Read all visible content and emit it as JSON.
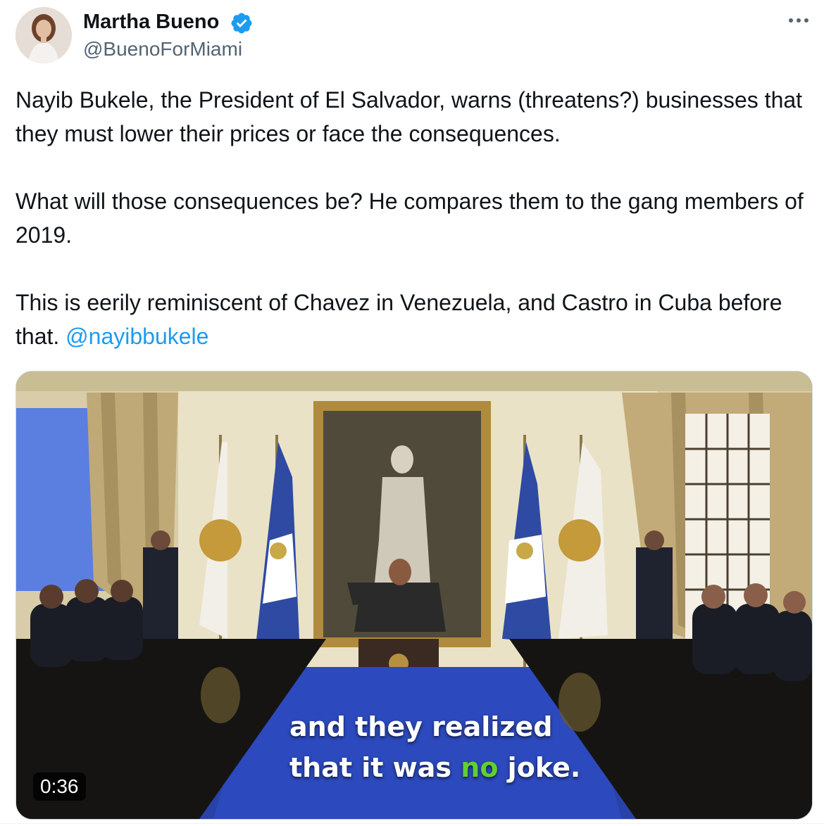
{
  "author": {
    "display_name": "Martha Bueno",
    "handle": "@BuenoForMiami",
    "verified_icon": "verified-badge-icon",
    "avatar_icon": "avatar"
  },
  "tweet": {
    "paragraphs": [
      "Nayib Bukele, the President of El Salvador, warns (threatens?) businesses that they must lower their prices or face the consequences.",
      "What will those consequences be? He compares them to the gang members of 2019."
    ],
    "last_paragraph_text": "This is eerily reminiscent of Chavez in Venezuela, and Castro in Cuba before that. ",
    "mention": "@nayibbukele"
  },
  "media": {
    "caption_line1": "and they realized",
    "caption_line2_before": "that it was ",
    "caption_line2_highlight": "no",
    "caption_line2_after": " joke.",
    "duration": "0:36",
    "highlight_color": "#5fd12e"
  },
  "colors": {
    "accent": "#1d9bf0",
    "text_primary": "#0f1419",
    "text_secondary": "#536471"
  }
}
